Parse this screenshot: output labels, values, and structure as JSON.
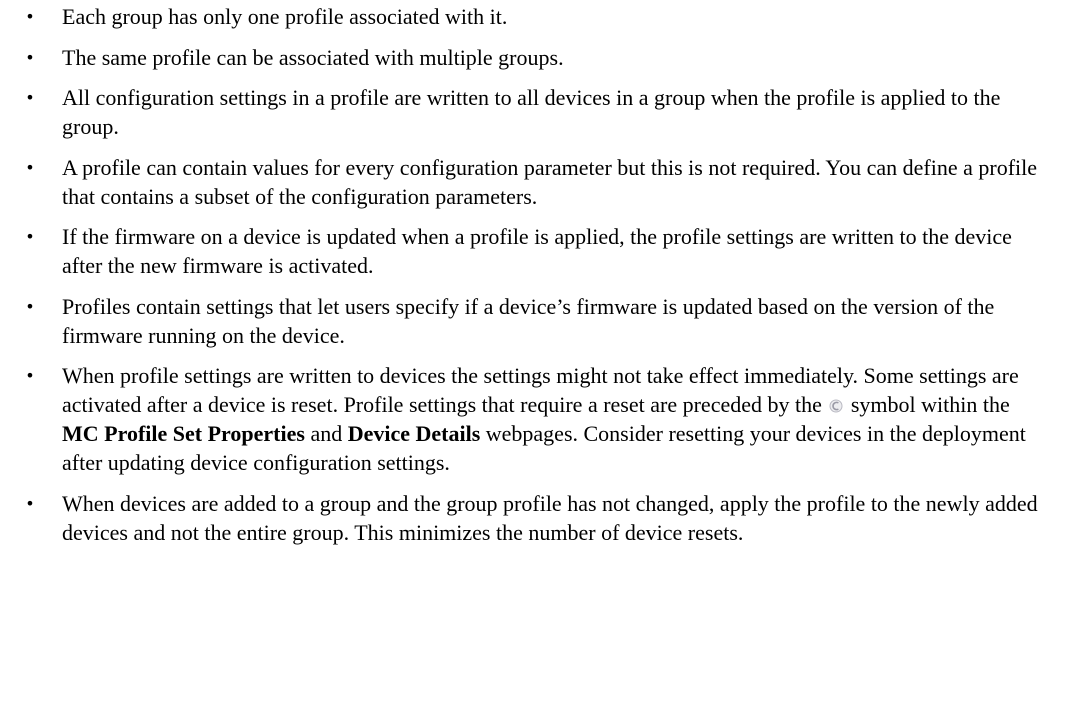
{
  "bullets": [
    "Each group has only one profile associated with it.",
    "The same profile can be associated with multiple groups.",
    "All configuration settings in a profile are written to all devices in a group when the profile is applied to the group.",
    "A profile can contain values for every configuration parameter but this is not required. You can define a profile that contains a subset of the configuration parameters.",
    "If the firmware on a device is updated when a profile is applied, the profile settings are written to the device after the new firmware is activated.",
    "Profiles contain settings that let users specify if a device’s firmware is updated based on the version of the firmware running on the device."
  ],
  "reset_bullet": {
    "part1": "When profile settings are written to devices the settings might not take effect immediately. Some settings are activated after a device is reset. Profile settings that require a reset are preceded by the",
    "part2": "symbol within the",
    "bold1": "MC Profile Set Properties",
    "part3": "and",
    "bold2": "Device Details",
    "part4": "webpages. Consider resetting your devices in the deployment after updating device configuration settings.",
    "icon": "reset-required-icon"
  },
  "last_bullet": "When devices are added to a group and the group profile has not changed, apply the profile to the newly added devices and not the entire group. This minimizes the number of device resets.",
  "bullet_glyph": "•"
}
